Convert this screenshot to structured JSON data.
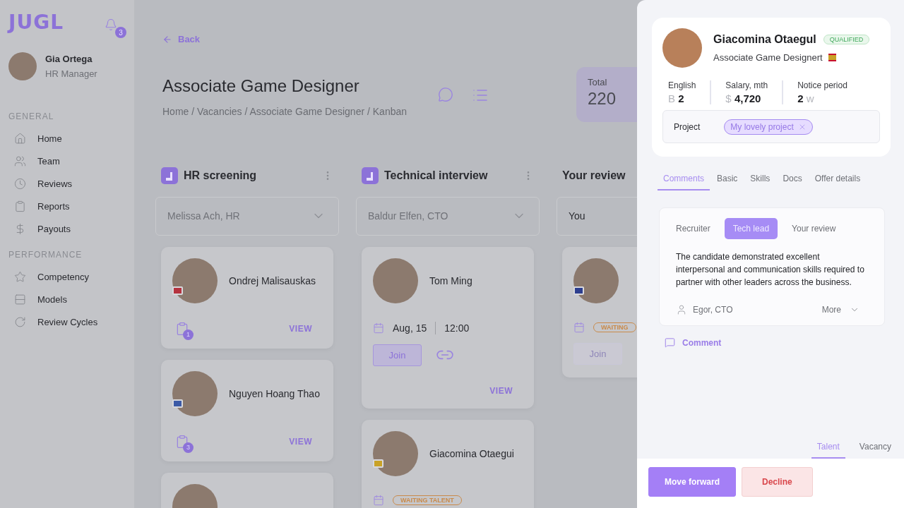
{
  "sidebar": {
    "logo": "JUGL",
    "notifications": "3",
    "user": {
      "name": "Gia Ortega",
      "role": "HR Manager"
    },
    "sections": [
      {
        "title": "GENERAL",
        "items": [
          {
            "label": "Home"
          },
          {
            "label": "Team"
          },
          {
            "label": "Reviews"
          },
          {
            "label": "Reports"
          },
          {
            "label": "Payouts"
          }
        ]
      },
      {
        "title": "PERFORMANCE",
        "items": [
          {
            "label": "Competency"
          },
          {
            "label": "Models"
          },
          {
            "label": "Review Cycles"
          }
        ]
      }
    ]
  },
  "header": {
    "back": "Back",
    "title": "Associate Game Designer",
    "breadcrumb": "Home / Vacancies / Associate Game Designer / Kanban",
    "total": {
      "label": "Total",
      "value": "220"
    }
  },
  "columns": [
    {
      "kind": "stage",
      "title": "HR screening",
      "assignee": {
        "placeholder": "Melissa Ach, HR"
      },
      "cards": [
        {
          "kind": "tasks",
          "name": "Ondrej Malisauskas",
          "color": "#b5333f",
          "tasks": "1",
          "view": "VIEW"
        },
        {
          "kind": "tasks",
          "name": "Nguyen Hoang Thao",
          "color": "#3c5aa6",
          "tasks": "3",
          "view": "VIEW"
        },
        {
          "kind": "tasks"
        }
      ]
    },
    {
      "kind": "stage",
      "title": "Technical interview",
      "assignee": {
        "placeholder": "Baldur Elfen, CTO"
      },
      "cards": [
        {
          "kind": "interview",
          "name": "Tom Ming",
          "date": "Aug, 15",
          "time": "12:00",
          "join": {
            "label": "Join",
            "disabled": false
          },
          "view": "VIEW"
        },
        {
          "kind": "interview",
          "name": "Giacomina Otaegui",
          "color": "#c9a227",
          "status": "WAITING TALENT"
        }
      ]
    },
    {
      "kind": "personal",
      "title": "Your review",
      "assignee": {
        "value": "You"
      },
      "cards": [
        {
          "kind": "interview",
          "color": "#2d3f8f",
          "status": "WAITING",
          "join": {
            "label": "Join",
            "disabled": true
          }
        }
      ]
    }
  ],
  "drawer": {
    "profile": {
      "name": "Giacomina Otaegul",
      "badge": "QUALIFIED",
      "role": "Associate Game Designert",
      "color": "#c9a227",
      "stats": [
        {
          "label": "English",
          "prefix": "B",
          "value": "2"
        },
        {
          "label": "Salary, mth",
          "prefix": "$",
          "value": "4,720"
        },
        {
          "label": "Notice period",
          "value": "2",
          "suffix": "w"
        }
      ],
      "project": {
        "label": "Project",
        "tag": "My lovely project"
      }
    },
    "tabs": [
      {
        "label": "Comments",
        "selected": true
      },
      {
        "label": "Basic",
        "selected": false
      },
      {
        "label": "Skills",
        "selected": false
      },
      {
        "label": "Docs",
        "selected": false
      },
      {
        "label": "Offer details",
        "selected": false
      }
    ],
    "review": {
      "tabs": [
        {
          "label": "Recruiter",
          "selected": false
        },
        {
          "label": "Tech lead",
          "selected": true
        },
        {
          "label": "Your review",
          "selected": false
        }
      ],
      "text": "The candidate demonstrated excellent interpersonal and communication skills required to partner with other leaders across the business.",
      "author": "Egor, CTO",
      "more": "More"
    },
    "comment": "Comment",
    "bottom_tabs": [
      {
        "label": "Talent",
        "selected": true
      },
      {
        "label": "Vacancy",
        "selected": false
      }
    ],
    "actions": [
      {
        "label": "Move forward",
        "kind": "primary"
      },
      {
        "label": "Decline",
        "kind": "danger"
      }
    ]
  }
}
